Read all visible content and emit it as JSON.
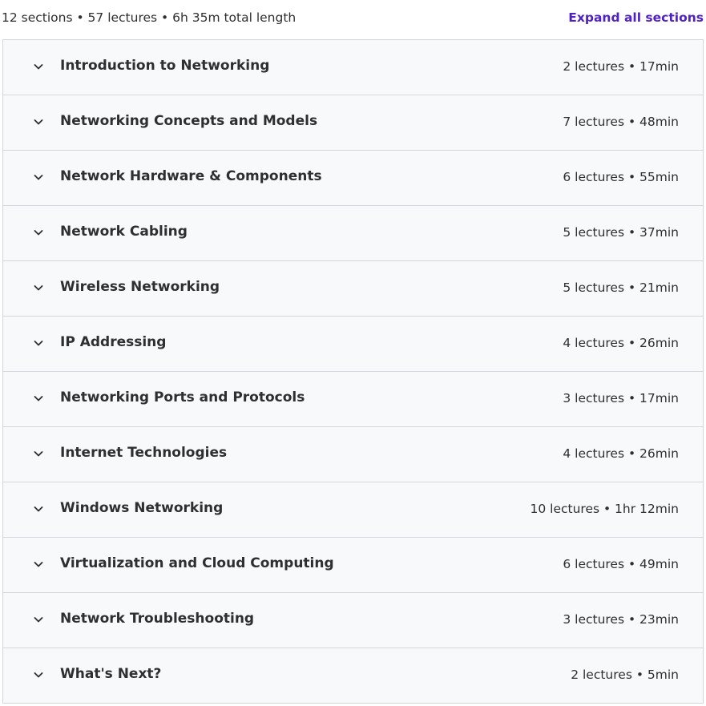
{
  "header": {
    "summary": "12 sections • 57 lectures • 6h 35m total length",
    "expand_all_label": "Expand all sections"
  },
  "colors": {
    "accent": "#5022c3",
    "section_bg": "#f7f9fa",
    "border": "#d1d7dc",
    "text": "#2d2f31"
  },
  "icons": {
    "section_toggle": "chevron-down-icon"
  },
  "sections": [
    {
      "title": "Introduction to Networking",
      "meta": "2 lectures • 17min"
    },
    {
      "title": "Networking Concepts and Models",
      "meta": "7 lectures • 48min"
    },
    {
      "title": "Network Hardware & Components",
      "meta": "6 lectures • 55min"
    },
    {
      "title": "Network Cabling",
      "meta": "5 lectures • 37min"
    },
    {
      "title": "Wireless Networking",
      "meta": "5 lectures • 21min"
    },
    {
      "title": "IP Addressing",
      "meta": "4 lectures • 26min"
    },
    {
      "title": "Networking Ports and Protocols",
      "meta": "3 lectures • 17min"
    },
    {
      "title": "Internet Technologies",
      "meta": "4 lectures • 26min"
    },
    {
      "title": "Windows Networking",
      "meta": "10 lectures • 1hr 12min"
    },
    {
      "title": "Virtualization and Cloud Computing",
      "meta": "6 lectures • 49min"
    },
    {
      "title": "Network Troubleshooting",
      "meta": "3 lectures • 23min"
    },
    {
      "title": "What's Next?",
      "meta": "2 lectures • 5min"
    }
  ]
}
